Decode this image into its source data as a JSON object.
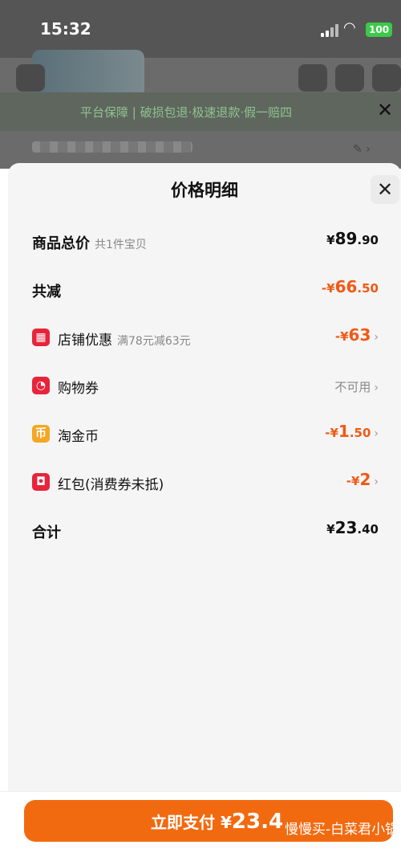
{
  "status_bar": {
    "time": "15:32",
    "battery": "100"
  },
  "banner": {
    "text": "平台保障 | 破损包退·极速退款·假一赔四"
  },
  "sheet": {
    "title": "价格明细",
    "rows": [
      {
        "label": "商品总价",
        "sub": "共1件宝贝",
        "symbol": "¥",
        "int": "89",
        "dec": ".90"
      },
      {
        "label": "共减",
        "symbol": "-¥",
        "int": "66",
        "dec": ".50"
      },
      {
        "label": "店铺优惠",
        "sub": "满78元减63元",
        "symbol": "-¥",
        "int": "63",
        "dec": ""
      },
      {
        "label": "购物券",
        "text": "不可用"
      },
      {
        "label": "淘金币",
        "symbol": "-¥",
        "int": "1",
        "dec": ".50"
      },
      {
        "label": "红包(消费券未抵)",
        "symbol": "-¥",
        "int": "2",
        "dec": ""
      },
      {
        "label": "合计",
        "symbol": "¥",
        "int": "23",
        "dec": ".40"
      }
    ]
  },
  "pay": {
    "label": "立即支付",
    "symbol": "¥",
    "amount": "23.4",
    "watermark": "慢慢买-白菜君小锅"
  },
  "colors": {
    "accent": "#f26a10",
    "discount": "#f05a14",
    "store_icon": "#e8243b",
    "coin_icon": "#f5a623"
  },
  "icons": [
    "store-icon",
    "coupon-icon",
    "coin-icon",
    "red-packet-icon"
  ]
}
